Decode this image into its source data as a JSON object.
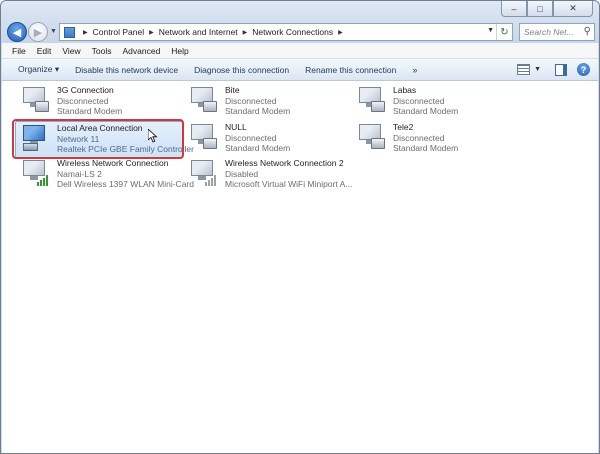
{
  "window": {
    "caption_buttons": {
      "minimize": "–",
      "maximize": "□",
      "close": "✕"
    }
  },
  "nav": {
    "back_glyph": "◀",
    "forward_glyph": "▶",
    "breadcrumb": [
      "Control Panel",
      "Network and Internet",
      "Network Connections"
    ],
    "search_placeholder": "Search Net..."
  },
  "menu": [
    "File",
    "Edit",
    "View",
    "Tools",
    "Advanced",
    "Help"
  ],
  "commands": {
    "organize": "Organize ▾",
    "disable": "Disable this network device",
    "diagnose": "Diagnose this connection",
    "rename": "Rename this connection",
    "more": "»",
    "help_glyph": "?"
  },
  "connections": [
    {
      "name": "3G Connection",
      "status": "Disconnected",
      "device": "Standard Modem",
      "kind": "modem",
      "selected": false
    },
    {
      "name": "Bite",
      "status": "Disconnected",
      "device": "Standard Modem",
      "kind": "modem",
      "selected": false
    },
    {
      "name": "Labas",
      "status": "Disconnected",
      "device": "Standard Modem",
      "kind": "modem",
      "selected": false
    },
    {
      "name": "Local Area Connection",
      "status": "Network 11",
      "device": "Realtek PCIe GBE Family Controller",
      "kind": "lan",
      "selected": true
    },
    {
      "name": "NULL",
      "status": "Disconnected",
      "device": "Standard Modem",
      "kind": "modem",
      "selected": false
    },
    {
      "name": "Tele2",
      "status": "Disconnected",
      "device": "Standard Modem",
      "kind": "modem",
      "selected": false
    },
    {
      "name": "Wireless Network Connection",
      "status": "Namai-LS 2",
      "device": "Dell Wireless 1397 WLAN Mini-Card",
      "kind": "wireless",
      "selected": false
    },
    {
      "name": "Wireless Network Connection 2",
      "status": "Disabled",
      "device": "Microsoft Virtual WiFi Miniport A...",
      "kind": "wireless-disabled",
      "selected": false
    }
  ],
  "colors": {
    "selection_border": "#84acdd",
    "highlight_ring": "#d0383a",
    "signal_green": "#2f9a2f"
  }
}
